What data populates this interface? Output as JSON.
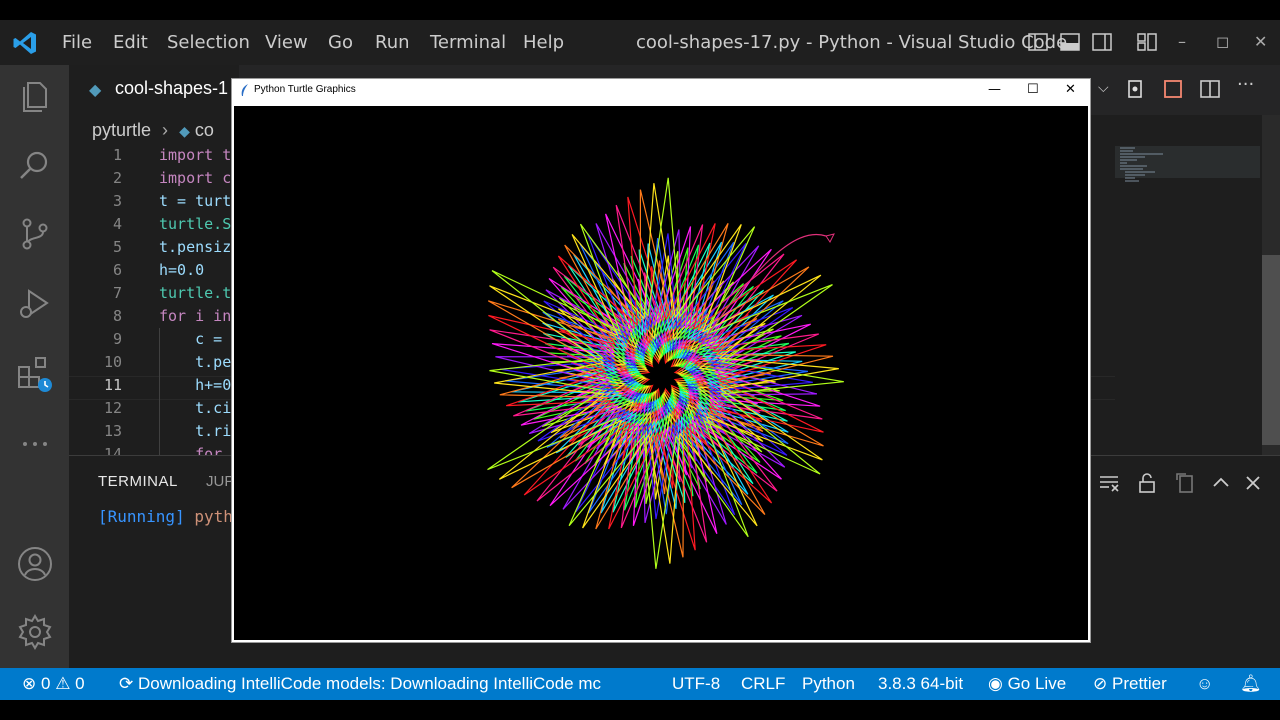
{
  "window": {
    "title": "cool-shapes-17.py - Python - Visual Studio Code",
    "controls": [
      "–",
      "◻",
      "✕"
    ]
  },
  "menu": [
    "File",
    "Edit",
    "Selection",
    "View",
    "Go",
    "Run",
    "Terminal",
    "Help"
  ],
  "activity_bar": [
    "explorer-icon",
    "search-icon",
    "source-control-icon",
    "run-debug-icon",
    "extensions-icon",
    "more-icon",
    "account-icon",
    "settings-gear-icon"
  ],
  "editor": {
    "tab_label": "cool-shapes-1",
    "breadcrumb": [
      "pyturtle",
      "co"
    ],
    "current_line": 11,
    "lines": [
      {
        "n": "1",
        "text": "import t"
      },
      {
        "n": "2",
        "text": "import c"
      },
      {
        "n": "3",
        "text": "t = turt"
      },
      {
        "n": "4",
        "text": "turtle.S"
      },
      {
        "n": "5",
        "text": "t.pensiz"
      },
      {
        "n": "6",
        "text": "h=0.0"
      },
      {
        "n": "7",
        "text": "turtle.t"
      },
      {
        "n": "8",
        "text": "for i in"
      },
      {
        "n": "9",
        "text": "    c = "
      },
      {
        "n": "10",
        "text": "    t.pe"
      },
      {
        "n": "11",
        "text": "    h+=0"
      },
      {
        "n": "12",
        "text": "    t.ci"
      },
      {
        "n": "13",
        "text": "    t.ri"
      },
      {
        "n": "14",
        "text": "    for"
      }
    ]
  },
  "panel": {
    "tabs": [
      "TERMINAL",
      "JUP"
    ],
    "terminal_running": "[Running]",
    "terminal_cmd": "pyth"
  },
  "turtle_window": {
    "title": "Python Turtle Graphics",
    "controls": [
      "—",
      "☐",
      "✕"
    ]
  },
  "statusbar": {
    "errors": "0",
    "warnings": "0",
    "message": "Downloading IntelliCode models: Downloading IntelliCode mc",
    "encoding": "UTF-8",
    "eol": "CRLF",
    "language": "Python",
    "interpreter": "3.8.3 64-bit",
    "golive": "Go Live",
    "prettier": "Prettier"
  },
  "colors": {
    "statusbar": "#007acc",
    "activitybar": "#333333",
    "editor_bg": "#1e1e1e"
  }
}
